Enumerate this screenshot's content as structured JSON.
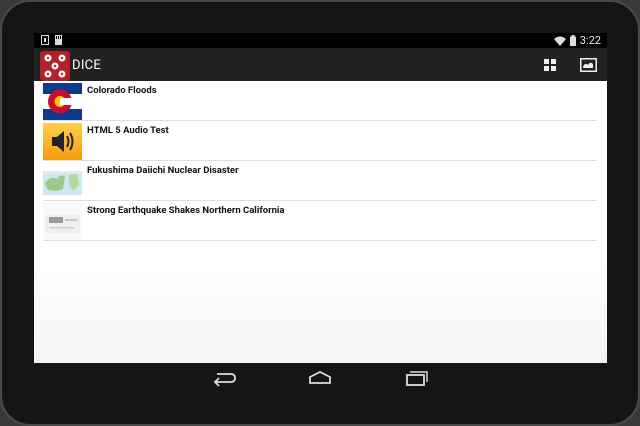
{
  "status_bar": {
    "time": "3:22"
  },
  "action_bar": {
    "title": "DICE",
    "brand_color": "#b3202a"
  },
  "list_items": [
    {
      "label": "Colorado Floods",
      "thumb_icon": "colorado-flag-thumbnail"
    },
    {
      "label": "HTML 5 Audio Test",
      "thumb_icon": "speaker-icon"
    },
    {
      "label": "Fukushima Daiichi Nuclear Disaster",
      "thumb_icon": "map-thumbnail"
    },
    {
      "label": "Strong Earthquake Shakes Northern California",
      "thumb_icon": "screenshot-thumbnail"
    }
  ],
  "colors": {
    "action_bar_bg": "#222222",
    "status_bar_bg": "#000000",
    "divider": "#dddddd"
  }
}
